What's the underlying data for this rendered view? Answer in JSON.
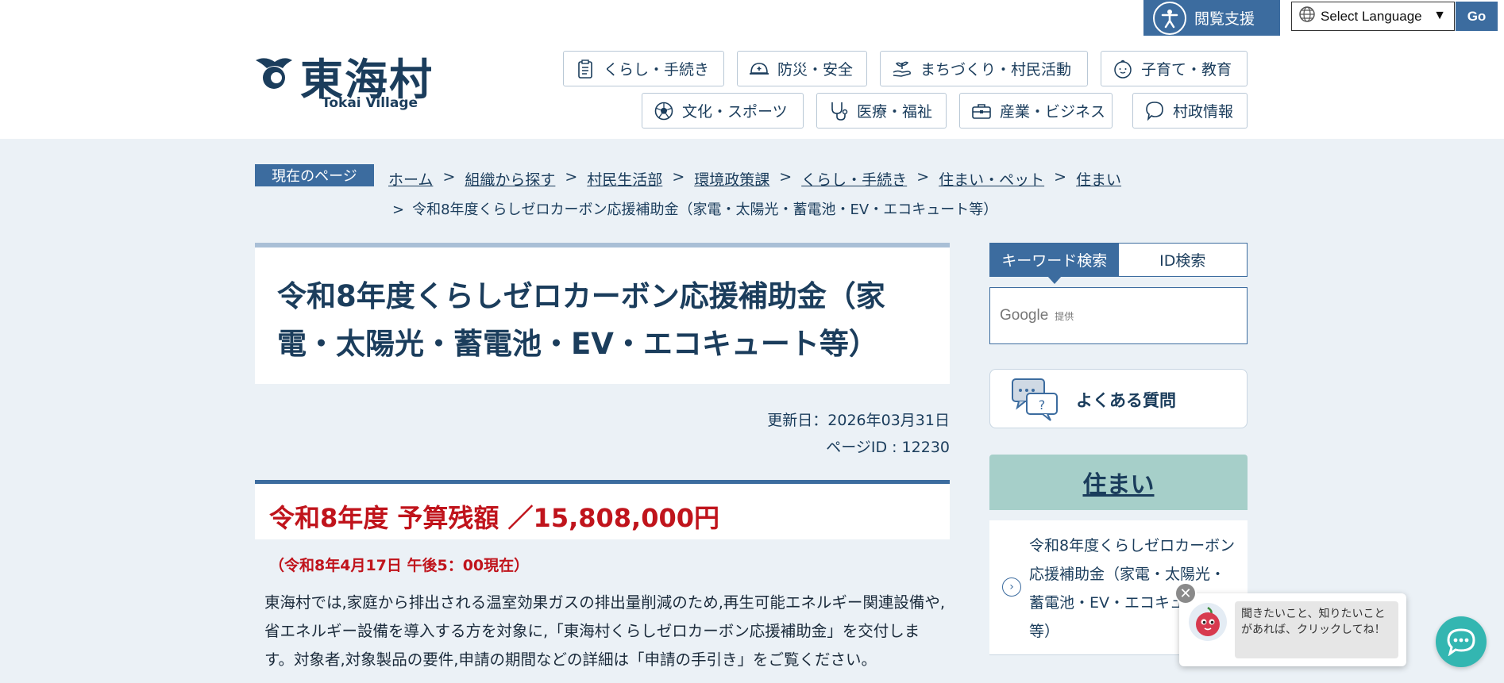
{
  "topbar": {
    "access_label": "閲覧支援",
    "language_select": "Select Language",
    "go_label": "Go"
  },
  "logo": {
    "name": "東海村",
    "subtitle": "Tokai Village"
  },
  "gnav": [
    {
      "label": "くらし・手続き",
      "icon": "clipboard-icon"
    },
    {
      "label": "防災・安全",
      "icon": "helmet-icon"
    },
    {
      "label": "まちづくり・村民活動",
      "icon": "hand-plant-icon"
    },
    {
      "label": "子育て・教育",
      "icon": "baby-icon"
    },
    {
      "label": "文化・スポーツ",
      "icon": "soccer-ball-icon"
    },
    {
      "label": "医療・福祉",
      "icon": "stethoscope-icon"
    },
    {
      "label": "産業・ビジネス",
      "icon": "briefcase-icon"
    },
    {
      "label": "村政情報",
      "icon": "speech-bubble-icon"
    }
  ],
  "breadcrumb": {
    "tag": "現在のページ",
    "items": [
      "ホーム",
      "組織から探す",
      "村民生活部",
      "環境政策課",
      "くらし・手続き",
      "住まい・ペット",
      "住まい"
    ],
    "current": "令和8年度くらしゼロカーボン応援補助金（家電・太陽光・蓄電池・EV・エコキュート等）"
  },
  "page": {
    "title": "令和8年度くらしゼロカーボン応援補助金（家電・太陽光・蓄電池・EV・エコキュート等）",
    "updated": "更新日：2026年03月31日",
    "page_id": "ページID : 12230",
    "budget": "令和8年度 予算残額 ／15,808,000円",
    "budget_date": "（令和8年4月17日 午後5：00現在）",
    "body": "東海村では,家庭から排出される温室効果ガスの排出量削減のため,再生可能エネルギー関連設備や,省エネルギー設備を導入する方を対象に,「東海村くらしゼロカーボン応援補助金」を交付します。対象者,対象製品の要件,申請の期間などの詳細は「申請の手引き」をご覧ください。"
  },
  "sidebar": {
    "tab_keyword": "キーワード検索",
    "tab_id": "ID検索",
    "google_label": "Google",
    "google_provided": "提供",
    "faq_label": "よくある質問",
    "category_title": "住まい",
    "category_item": "令和8年度くらしゼロカーボン応援補助金（家電・太陽光・蓄電池・EV・エコキュート等）"
  },
  "chat": {
    "message": "聞きたいこと、知りたいことがあれば、クリックしてね！",
    "close_symbol": "✕"
  },
  "colors": {
    "primary": "#3c6c9f",
    "budget_red": "#c0141c",
    "category_bg": "#a6cfc9",
    "chat_fab": "#33b6b1"
  }
}
